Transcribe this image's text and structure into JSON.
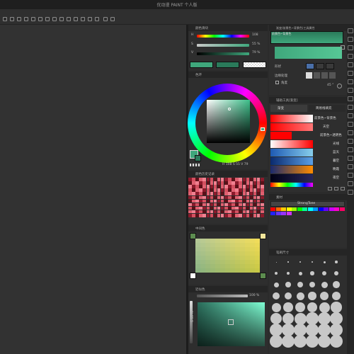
{
  "window": {
    "title": "优动漫 PAINT 个人版"
  },
  "colors": {
    "main": "#3fa77c",
    "sub": "#2a7a5a",
    "accent": "#4a90e2",
    "panel_bg": "#2e2e2e"
  },
  "palettes": {
    "color_sliders": {
      "header": "颜色滑块",
      "rows": [
        {
          "label": "H",
          "value": "108"
        },
        {
          "label": "S",
          "value": "55 %"
        },
        {
          "label": "V",
          "value": "79 %"
        }
      ]
    },
    "color_wheel": {
      "header": "色环",
      "readout": "H 108  S 55  V 79"
    },
    "color_history": {
      "header": "颜色历史记录"
    },
    "intermediate": {
      "header": "中间色"
    },
    "approx": {
      "header": "近似色",
      "zoom": "100 %",
      "side_label": "S 55 %"
    },
    "tool_property": {
      "header": "渐变(前景色~背景色)工具属性",
      "gradient_label": "前景色~背景色",
      "shape_label": "形状",
      "edge_label": "边缘处理",
      "angle_label": "角度",
      "angle_value": "45 °"
    },
    "sub_tool": {
      "header": "辅助工具[渐变]",
      "tabs": [
        "渐变",
        "简易线填充"
      ],
      "items": [
        "前景色~背景色",
        "天空",
        "前景色~透明色",
        "光线",
        "蓝天",
        "暮空",
        "晚霞",
        "夜空"
      ]
    },
    "material": {
      "header": "素材",
      "list_label": "StrongTone"
    },
    "brush_size": {
      "header": "笔刷尺寸"
    }
  },
  "icons": [
    "undo-icon",
    "redo-icon",
    "transform-icon",
    "selection-icon",
    "pen-icon",
    "eraser-icon"
  ]
}
